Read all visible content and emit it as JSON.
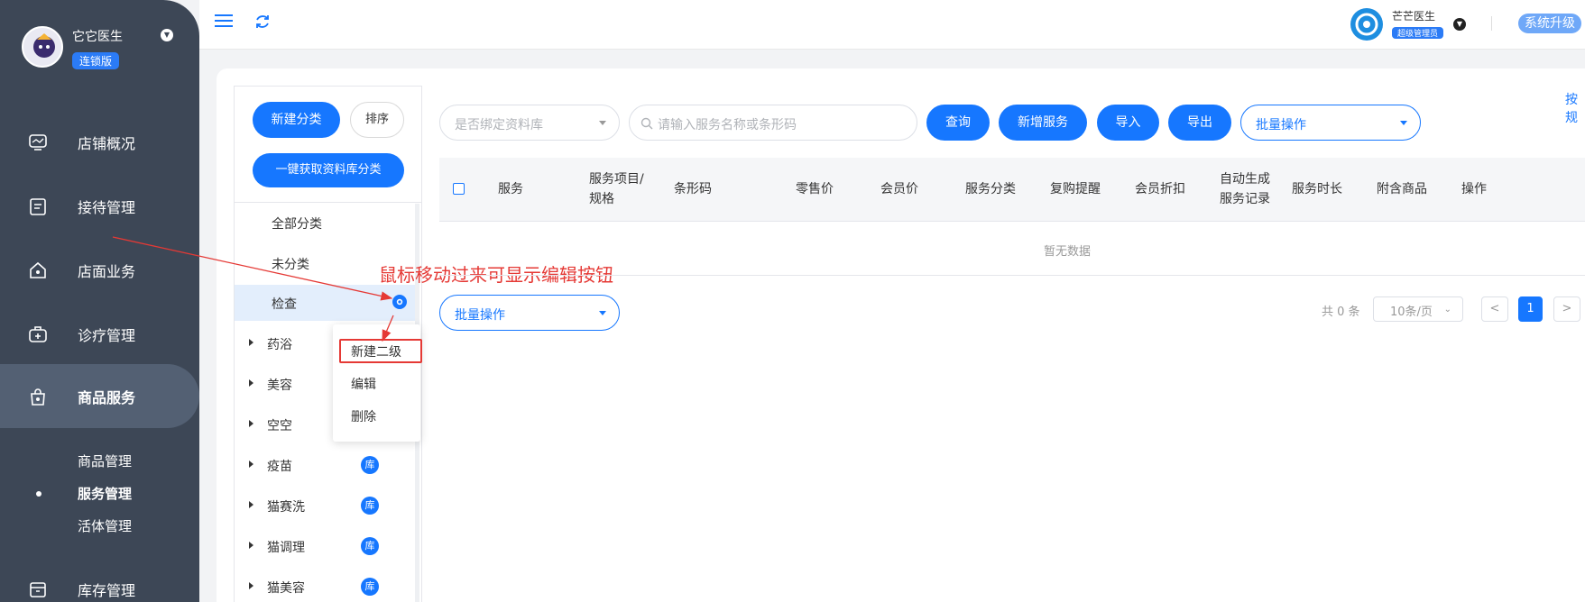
{
  "sidebar": {
    "shop_name": "它它医生",
    "edition": "连锁版",
    "nav": [
      {
        "label": "店铺概况",
        "icon": "monitor-icon"
      },
      {
        "label": "接待管理",
        "icon": "clipboard-icon"
      },
      {
        "label": "店面业务",
        "icon": "house-icon"
      },
      {
        "label": "诊疗管理",
        "icon": "medkit-icon"
      },
      {
        "label": "商品服务",
        "icon": "bag-icon"
      },
      {
        "label": "库存管理",
        "icon": "box-icon"
      }
    ],
    "sub_items": [
      "商品管理",
      "服务管理",
      "活体管理"
    ]
  },
  "topbar": {
    "user_name": "芒芒医生",
    "user_role": "超级管理员",
    "upgrade_label": "系统升级"
  },
  "categories": {
    "new_label": "新建分类",
    "sort_label": "排序",
    "fetch_label": "一键获取资料库分类",
    "items": [
      {
        "label": "全部分类"
      },
      {
        "label": "未分类"
      },
      {
        "label": "检查"
      },
      {
        "label": "药浴"
      },
      {
        "label": "美容"
      },
      {
        "label": "空空"
      },
      {
        "label": "疫苗",
        "badge": "库"
      },
      {
        "label": "猫赛洗",
        "badge": "库"
      },
      {
        "label": "猫调理",
        "badge": "库"
      },
      {
        "label": "猫美容",
        "badge": "库"
      }
    ]
  },
  "context_menu": {
    "items": [
      "新建二级",
      "编辑",
      "删除"
    ]
  },
  "annotation": "鼠标移动过来可显示编辑按钮",
  "filters": {
    "bind_placeholder": "是否绑定资料库",
    "search_placeholder": "请输入服务名称或条形码",
    "query_label": "查询",
    "add_label": "新增服务",
    "import_label": "导入",
    "export_label": "导出",
    "batch_label": "批量操作",
    "cut_link": "按规"
  },
  "table": {
    "headers": [
      "服务",
      "服务项目/规格",
      "条形码",
      "零售价",
      "会员价",
      "服务分类",
      "复购提醒",
      "会员折扣",
      "自动生成服务记录",
      "服务时长",
      "附含商品",
      "操作"
    ],
    "empty_text": "暂无数据"
  },
  "footer": {
    "batch_label": "批量操作",
    "total_text": "共 0 条",
    "page_size": "10条/页",
    "current_page": "1",
    "prev": "<",
    "next": ">"
  }
}
